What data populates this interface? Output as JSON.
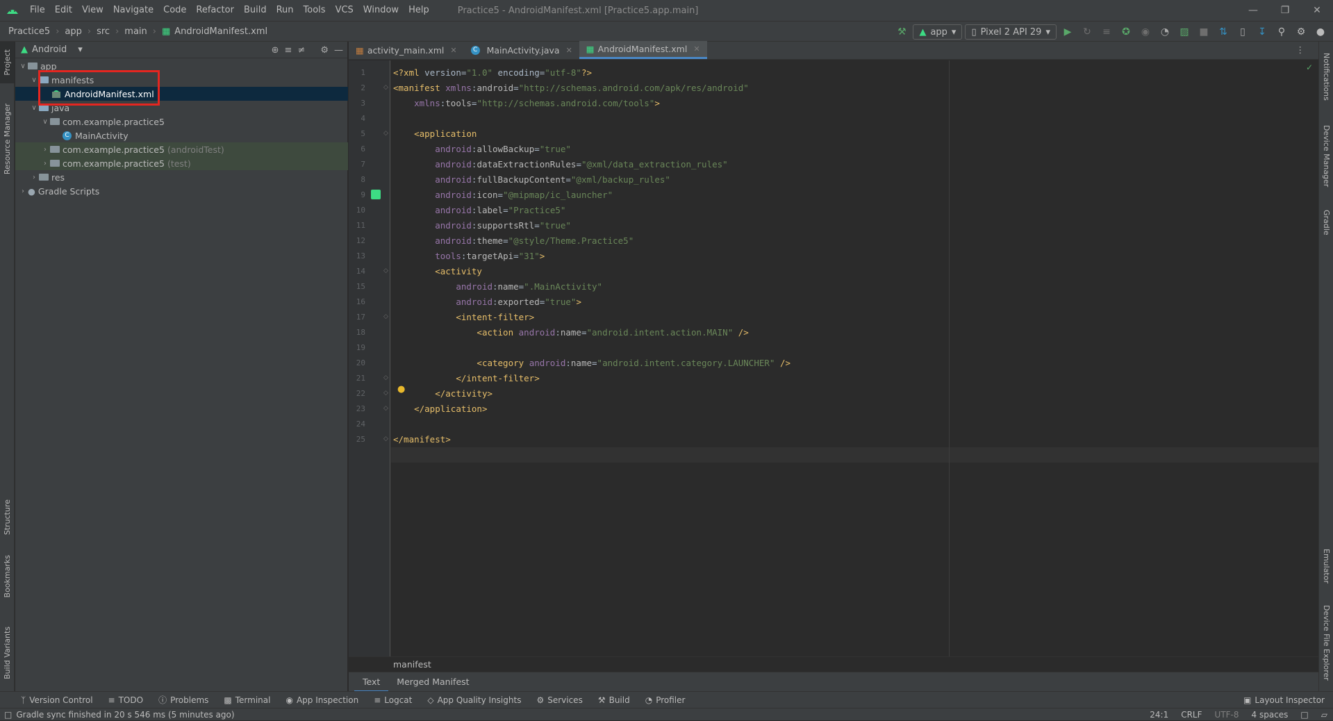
{
  "menu": [
    "File",
    "Edit",
    "View",
    "Navigate",
    "Code",
    "Refactor",
    "Build",
    "Run",
    "Tools",
    "VCS",
    "Window",
    "Help"
  ],
  "window_title": "Practice5 - AndroidManifest.xml [Practice5.app.main]",
  "breadcrumb": [
    "Practice5",
    "app",
    "src",
    "main",
    "AndroidManifest.xml"
  ],
  "toolbar": {
    "run_config": "app",
    "device": "Pixel 2 API 29"
  },
  "project_panel": {
    "view_mode": "Android",
    "tree": [
      {
        "label": "app",
        "suffix": ""
      },
      {
        "label": "manifests",
        "suffix": ""
      },
      {
        "label": "AndroidManifest.xml",
        "suffix": ""
      },
      {
        "label": "java",
        "suffix": ""
      },
      {
        "label": "com.example.practice5",
        "suffix": ""
      },
      {
        "label": "MainActivity",
        "suffix": ""
      },
      {
        "label": "com.example.practice5",
        "suffix": "(androidTest)"
      },
      {
        "label": "com.example.practice5",
        "suffix": "(test)"
      },
      {
        "label": "res",
        "suffix": ""
      },
      {
        "label": "Gradle Scripts",
        "suffix": ""
      }
    ]
  },
  "left_tool_tabs": [
    "Project",
    "Resource Manager",
    "Structure",
    "Bookmarks",
    "Build Variants"
  ],
  "right_tool_tabs": [
    "Notifications",
    "Device Manager",
    "Gradle",
    "Emulator",
    "Device File Explorer"
  ],
  "editor_tabs": [
    "activity_main.xml",
    "MainActivity.java",
    "AndroidManifest.xml"
  ],
  "line_numbers": [
    "1",
    "2",
    "3",
    "4",
    "5",
    "6",
    "7",
    "8",
    "9",
    "10",
    "11",
    "12",
    "13",
    "14",
    "15",
    "16",
    "17",
    "18",
    "19",
    "20",
    "21",
    "22",
    "23",
    "24",
    "25"
  ],
  "code": [
    "<?xml version=\"1.0\" encoding=\"utf-8\"?>",
    "<manifest xmlns:android=\"http://schemas.android.com/apk/res/android\"",
    "    xmlns:tools=\"http://schemas.android.com/tools\">",
    "",
    "    <application",
    "        android:allowBackup=\"true\"",
    "        android:dataExtractionRules=\"@xml/data_extraction_rules\"",
    "        android:fullBackupContent=\"@xml/backup_rules\"",
    "        android:icon=\"@mipmap/ic_launcher\"",
    "        android:label=\"Practice5\"",
    "        android:supportsRtl=\"true\"",
    "        android:theme=\"@style/Theme.Practice5\"",
    "        tools:targetApi=\"31\">",
    "        <activity",
    "            android:name=\".MainActivity\"",
    "            android:exported=\"true\">",
    "            <intent-filter>",
    "                <action android:name=\"android.intent.action.MAIN\" />",
    "",
    "                <category android:name=\"android.intent.category.LAUNCHER\" />",
    "            </intent-filter>",
    "        </activity>",
    "    </application>",
    "",
    "</manifest>"
  ],
  "editor_breadcrumb": "manifest",
  "editor_view_tabs": [
    "Text",
    "Merged Manifest"
  ],
  "bottom_tools": [
    "Version Control",
    "TODO",
    "Problems",
    "Terminal",
    "App Inspection",
    "Logcat",
    "App Quality Insights",
    "Services",
    "Build",
    "Profiler",
    "Layout Inspector"
  ],
  "status": {
    "message": "Gradle sync finished in 20 s 546 ms (5 minutes ago)",
    "position": "24:1",
    "line_sep": "CRLF",
    "encoding": "UTF-8",
    "indent": "4 spaces"
  }
}
